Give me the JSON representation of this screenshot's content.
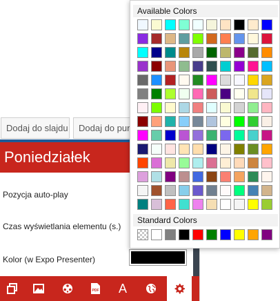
{
  "buttons": {
    "add_to_slide": "Dodaj do slajdu",
    "add_to_point": "Dodaj do punktu"
  },
  "header": {
    "day": "Poniedziałek"
  },
  "settings": {
    "autoplay_label": "Pozycja auto-play",
    "duration_label": "Czas wyświetlania elementu (s.)",
    "color_label": "Kolor (w Expo Presenter)",
    "color_value": "#000000"
  },
  "popup": {
    "available_title": "Available Colors",
    "standard_title": "Standard Colors",
    "available_colors": [
      [
        "#f0f8ff",
        "#fafad2",
        "#00ffff",
        "#7fffd4",
        "#f0ffff",
        "#f5f5dc",
        "#ffe4c4",
        "#000000",
        "#ffebcd",
        "#0000ff"
      ],
      [
        "#8a2be2",
        "#a52a2a",
        "#deb887",
        "#5f9ea0",
        "#7fff00",
        "#d2691e",
        "#ff7f50",
        "#6495ed",
        "#fff8dc",
        "#dc143c"
      ],
      [
        "#00ffff",
        "#00008b",
        "#008b8b",
        "#b8860b",
        "#a9a9a9",
        "#006400",
        "#bdb76b",
        "#8b008b",
        "#556b2f",
        "#ff8c00"
      ],
      [
        "#9932cc",
        "#8b0000",
        "#e9967a",
        "#8fbc8f",
        "#483d8b",
        "#2f4f4f",
        "#00ced1",
        "#9400d3",
        "#ff1493",
        "#00bfff"
      ],
      [
        "#696969",
        "#1e90ff",
        "#b22222",
        "#fffaf0",
        "#228b22",
        "#ff00ff",
        "#dcdcdc",
        "#f8f8ff",
        "#ffd700",
        "#daa520"
      ],
      [
        "#808080",
        "#008000",
        "#adff2f",
        "#f0fff0",
        "#ff69b4",
        "#cd5c5c",
        "#4b0082",
        "#fffff0",
        "#f0e68c",
        "#e6e6fa"
      ],
      [
        "#fff0f5",
        "#7cfc00",
        "#fffacd",
        "#add8e6",
        "#f08080",
        "#e0ffff",
        "#fafad2",
        "#d3d3d3",
        "#90ee90",
        "#ffb6c1"
      ],
      [
        "#8b0000",
        "#ffa07a",
        "#20b2aa",
        "#87cefa",
        "#778899",
        "#b0c4de",
        "#ffffe0",
        "#00ff00",
        "#32cd32",
        "#faf0e6"
      ],
      [
        "#ff00ff",
        "#66cdaa",
        "#0000cd",
        "#ba55d3",
        "#9370db",
        "#3cb371",
        "#7b68ee",
        "#00fa9a",
        "#48d1cc",
        "#c71585"
      ],
      [
        "#191970",
        "#f5fffa",
        "#ffe4e1",
        "#ffe4b5",
        "#ffdead",
        "#000080",
        "#fdf5e6",
        "#808000",
        "#6b8e23",
        "#ffa500"
      ],
      [
        "#ff4500",
        "#da70d6",
        "#eee8aa",
        "#98fb98",
        "#afeeee",
        "#db7093",
        "#ffefd5",
        "#ffdab9",
        "#cd853f",
        "#ffc0cb"
      ],
      [
        "#dda0dd",
        "#b0e0e6",
        "#800080",
        "#bc8f8f",
        "#4169e1",
        "#8b4513",
        "#fa8072",
        "#f4a460",
        "#2e8b57",
        "#fff5ee"
      ],
      [
        "#f5f5f5",
        "#a0522d",
        "#c0c0c0",
        "#87ceeb",
        "#6a5acd",
        "#708090",
        "#fffafa",
        "#00ff7f",
        "#4682b4",
        "#d2b48c"
      ],
      [
        "#008080",
        "#d8bfd8",
        "#ff6347",
        "#40e0d0",
        "#ee82ee",
        "#f5deb3",
        "#ffffff",
        "#f5f5f5",
        "#ffff00",
        "#9acd32"
      ]
    ],
    "standard_colors": [
      "transparent",
      "#ffffff",
      "#808080",
      "#000000",
      "#ff0000",
      "#008000",
      "#0000ff",
      "#ffff00",
      "#ffa500",
      "#800080"
    ]
  },
  "toolbar": {
    "tools": [
      "copy-icon",
      "image-icon",
      "video-reel-icon",
      "pdf-icon",
      "text-icon",
      "globe-icon",
      "gear-icon"
    ],
    "text_glyph": "A",
    "pdf_glyph": "PDF",
    "active": "gear-icon"
  }
}
